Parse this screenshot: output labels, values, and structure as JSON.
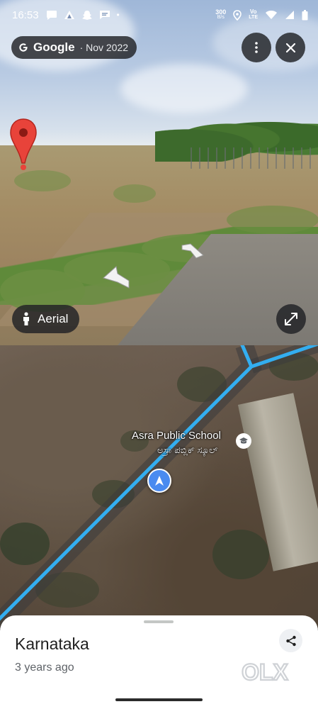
{
  "status_bar": {
    "time": "16:53",
    "net_speed_value": "300",
    "net_speed_unit": "B/s",
    "volte_top": "Vo",
    "volte_bottom": "LTE",
    "dot": "•"
  },
  "street_view": {
    "brand": "Google",
    "date": "· Nov 2022",
    "aerial_label": "Aerial"
  },
  "map": {
    "place_label": "Asra Public School",
    "place_label_local": "ಅಸ್ರಾ ಪಬ್ಲಿಕ್ ಸ್ಕೂಲ್"
  },
  "sheet": {
    "title": "Karnataka",
    "subtitle": "3 years ago"
  },
  "watermark": "OLX",
  "colors": {
    "route_blue": "#33aef0",
    "pin_red": "#e8433a",
    "nav_blue": "#4a8bf0"
  }
}
